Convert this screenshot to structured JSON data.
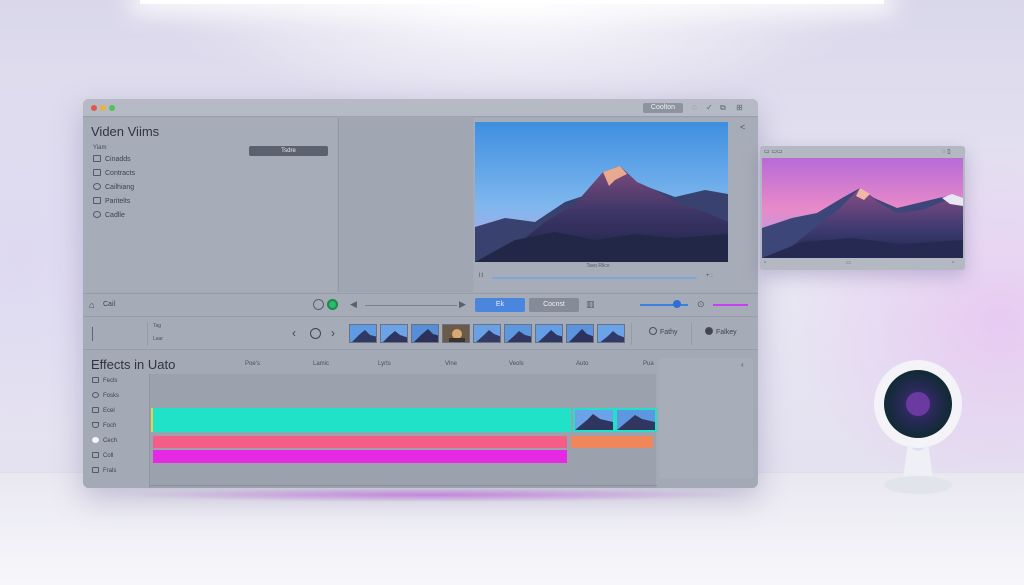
{
  "titlebar": {
    "button_label": "Coolton"
  },
  "left_panel": {
    "title": "Viden Viims",
    "section_label": "Yiam",
    "field_label": "Tsdre",
    "items": [
      {
        "label": "Cinadds",
        "icon": "film-icon"
      },
      {
        "label": "Contracts",
        "icon": "grid-icon"
      },
      {
        "label": "Cailhiang",
        "icon": "clock-icon"
      },
      {
        "label": "Paritelts",
        "icon": "folder-icon"
      },
      {
        "label": "Cadlle",
        "icon": "settings-icon"
      }
    ]
  },
  "viewer": {
    "video_label": "Tavo Rlico",
    "time_start": "l:l",
    "time_end": "+ :"
  },
  "toolbar": {
    "label": "Cail",
    "primary_button": "Ek",
    "secondary_button": "Cocnst"
  },
  "filmstrip": {
    "labels": [
      "Tag",
      "Laar"
    ],
    "chips": [
      {
        "label": "Fathy",
        "icon": "gear-icon"
      },
      {
        "label": "Falkey",
        "icon": "record-icon"
      }
    ]
  },
  "effects": {
    "title": "Effects in Uato",
    "columns": [
      "Poe's",
      "Lamic",
      "Lyrts",
      "Vlne",
      "Veols",
      "Auto",
      "Pua"
    ],
    "items": [
      "Fecls",
      "Fosks",
      "Ecel",
      "Foch",
      "Cech",
      "Coll",
      "Frals"
    ]
  },
  "colors": {
    "cyan_track": "#20e2c9",
    "coral_track": "#f35d86",
    "orange_track": "#f0875a",
    "magenta_track": "#e62ae3",
    "accent_blue": "#4a86dd"
  }
}
